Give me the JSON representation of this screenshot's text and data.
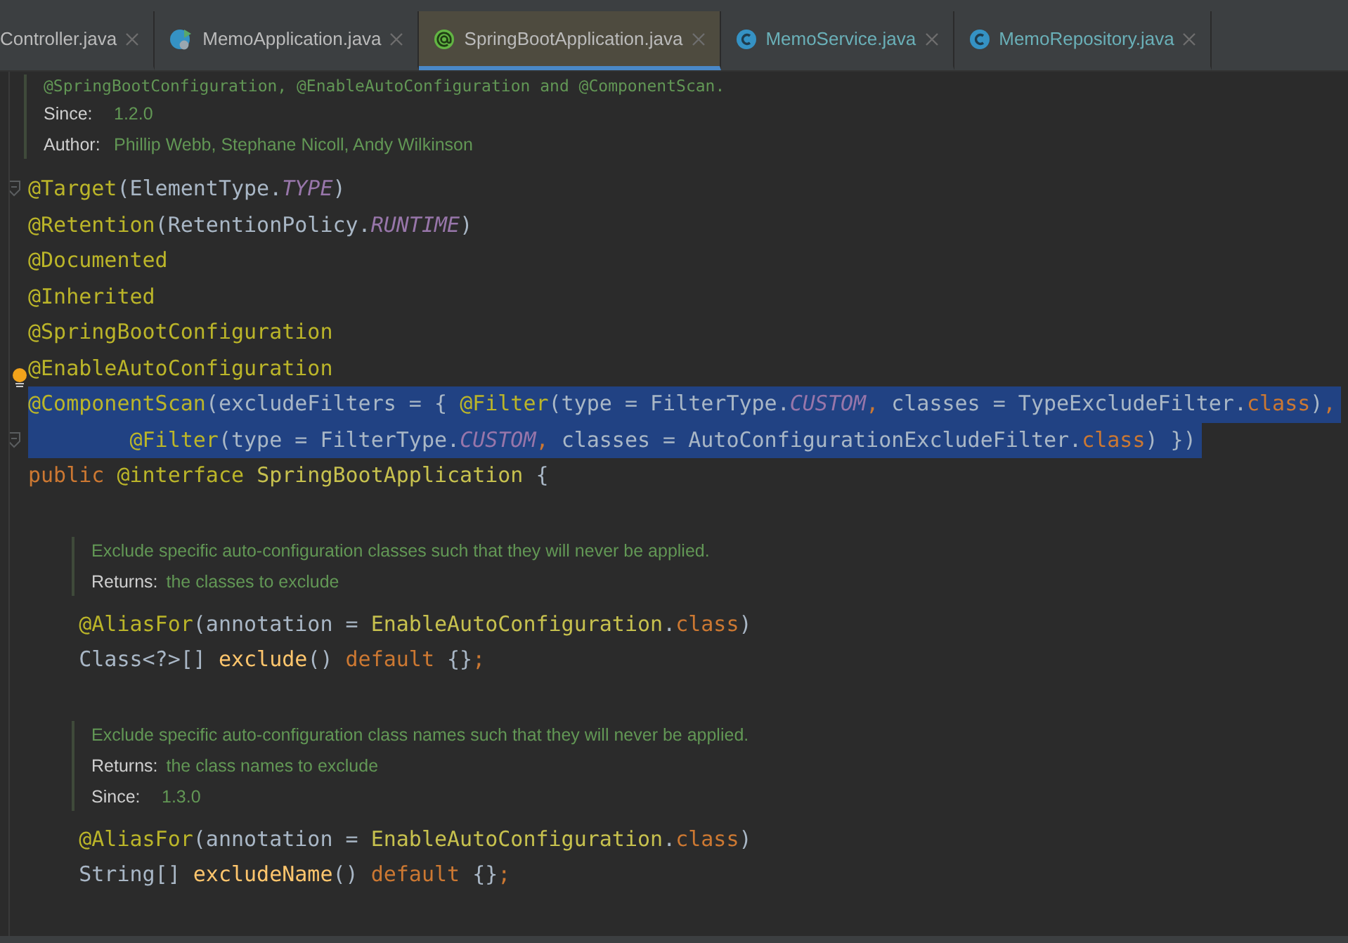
{
  "tabs": [
    {
      "label": "Controller.java",
      "kind": "none",
      "selected": false,
      "color": "#bbbbbb"
    },
    {
      "label": "MemoApplication.java",
      "kind": "app-class",
      "selected": false,
      "color": "#bbbbbb"
    },
    {
      "label": "SpringBootApplication.java",
      "kind": "annotation",
      "selected": true,
      "color": "#bbbbbb"
    },
    {
      "label": "MemoService.java",
      "kind": "class",
      "selected": false,
      "color": "#6ab0b8"
    },
    {
      "label": "MemoRepository.java",
      "kind": "class",
      "selected": false,
      "color": "#6ab0b8"
    }
  ],
  "editor": {
    "blocks": [
      {
        "kind": "doc",
        "indented": false,
        "lines": [
          {
            "kind": "mono",
            "text": "@SpringBootConfiguration, @EnableAutoConfiguration and @ComponentScan."
          },
          {
            "kind": "field",
            "label": "Since:",
            "text": "1.2.0"
          },
          {
            "kind": "field",
            "label": "Author:",
            "text": "Phillip Webb, Stephane Nicoll, Andy Wilkinson"
          }
        ]
      },
      {
        "kind": "code",
        "fold": true,
        "bulb": false,
        "selected": false,
        "tokens": [
          {
            "t": "@Target",
            "kind": "annotation"
          },
          {
            "t": "(ElementType.",
            "kind": "plain"
          },
          {
            "t": "TYPE",
            "kind": "constant"
          },
          {
            "t": ")",
            "kind": "plain"
          }
        ]
      },
      {
        "kind": "code",
        "fold": false,
        "bulb": false,
        "selected": false,
        "tokens": [
          {
            "t": "@Retention",
            "kind": "annotation"
          },
          {
            "t": "(RetentionPolicy.",
            "kind": "plain"
          },
          {
            "t": "RUNTIME",
            "kind": "constant"
          },
          {
            "t": ")",
            "kind": "plain"
          }
        ]
      },
      {
        "kind": "code",
        "fold": false,
        "bulb": false,
        "selected": false,
        "tokens": [
          {
            "t": "@Documented",
            "kind": "annotation"
          }
        ]
      },
      {
        "kind": "code",
        "fold": false,
        "bulb": false,
        "selected": false,
        "tokens": [
          {
            "t": "@Inherited",
            "kind": "annotation"
          }
        ]
      },
      {
        "kind": "code",
        "fold": false,
        "bulb": false,
        "selected": false,
        "tokens": [
          {
            "t": "@SpringBootConfiguration",
            "kind": "annotation"
          }
        ]
      },
      {
        "kind": "code",
        "fold": false,
        "bulb": true,
        "selected": false,
        "tokens": [
          {
            "t": "@EnableAutoConfiguration",
            "kind": "annotation"
          }
        ]
      },
      {
        "kind": "code",
        "fold": false,
        "bulb": false,
        "selected": true,
        "tokens": [
          {
            "t": "@ComponentScan",
            "kind": "annotation"
          },
          {
            "t": "(excludeFilters = { ",
            "kind": "plain"
          },
          {
            "t": "@Filter",
            "kind": "annotation"
          },
          {
            "t": "(type = FilterType.",
            "kind": "plain"
          },
          {
            "t": "CUSTOM",
            "kind": "constant"
          },
          {
            "t": ", ",
            "kind": "keyword"
          },
          {
            "t": "classes = TypeExcludeFilter.",
            "kind": "plain"
          },
          {
            "t": "class",
            "kind": "keyword"
          },
          {
            "t": ")",
            "kind": "plain"
          },
          {
            "t": ",",
            "kind": "keyword"
          }
        ]
      },
      {
        "kind": "code",
        "fold": true,
        "bulb": false,
        "selected": true,
        "tokens": [
          {
            "t": "        @Filter",
            "kind": "annotation"
          },
          {
            "t": "(type = FilterType.",
            "kind": "plain"
          },
          {
            "t": "CUSTOM",
            "kind": "constant"
          },
          {
            "t": ", ",
            "kind": "keyword"
          },
          {
            "t": "classes = AutoConfigurationExcludeFilter.",
            "kind": "plain"
          },
          {
            "t": "class",
            "kind": "keyword"
          },
          {
            "t": ") })",
            "kind": "plain"
          }
        ]
      },
      {
        "kind": "code",
        "fold": false,
        "bulb": false,
        "selected": false,
        "tokens": [
          {
            "t": "public ",
            "kind": "keyword"
          },
          {
            "t": "@interface ",
            "kind": "annotation"
          },
          {
            "t": "SpringBootApplication ",
            "kind": "type"
          },
          {
            "t": "{",
            "kind": "plain"
          }
        ]
      },
      {
        "kind": "blank"
      },
      {
        "kind": "doc",
        "indented": true,
        "lines": [
          {
            "kind": "text",
            "text": "Exclude specific auto-configuration classes such that they will never be applied."
          },
          {
            "kind": "field",
            "label": "Returns:",
            "text": "the classes to exclude"
          }
        ]
      },
      {
        "kind": "code",
        "fold": false,
        "bulb": false,
        "selected": false,
        "tokens": [
          {
            "t": "    @AliasFor",
            "kind": "annotation"
          },
          {
            "t": "(annotation = ",
            "kind": "plain"
          },
          {
            "t": "EnableAutoConfiguration",
            "kind": "type"
          },
          {
            "t": ".",
            "kind": "plain"
          },
          {
            "t": "class",
            "kind": "keyword"
          },
          {
            "t": ")",
            "kind": "plain"
          }
        ]
      },
      {
        "kind": "code",
        "fold": false,
        "bulb": false,
        "selected": false,
        "tokens": [
          {
            "t": "    Class<?>[] ",
            "kind": "plain"
          },
          {
            "t": "exclude",
            "kind": "method"
          },
          {
            "t": "() ",
            "kind": "plain"
          },
          {
            "t": "default ",
            "kind": "keyword"
          },
          {
            "t": "{}",
            "kind": "plain"
          },
          {
            "t": ";",
            "kind": "keyword"
          }
        ]
      },
      {
        "kind": "blank"
      },
      {
        "kind": "doc",
        "indented": true,
        "lines": [
          {
            "kind": "text",
            "text": "Exclude specific auto-configuration class names such that they will never be applied."
          },
          {
            "kind": "field",
            "label": "Returns:",
            "text": "the class names to exclude"
          },
          {
            "kind": "field",
            "label": "Since:",
            "text": "1.3.0"
          }
        ]
      },
      {
        "kind": "code",
        "fold": false,
        "bulb": false,
        "selected": false,
        "tokens": [
          {
            "t": "    @AliasFor",
            "kind": "annotation"
          },
          {
            "t": "(annotation = ",
            "kind": "plain"
          },
          {
            "t": "EnableAutoConfiguration",
            "kind": "type"
          },
          {
            "t": ".",
            "kind": "plain"
          },
          {
            "t": "class",
            "kind": "keyword"
          },
          {
            "t": ")",
            "kind": "plain"
          }
        ]
      },
      {
        "kind": "code",
        "fold": false,
        "bulb": false,
        "selected": false,
        "tokens": [
          {
            "t": "    String[] ",
            "kind": "plain"
          },
          {
            "t": "excludeName",
            "kind": "method"
          },
          {
            "t": "() ",
            "kind": "plain"
          },
          {
            "t": "default ",
            "kind": "keyword"
          },
          {
            "t": "{}",
            "kind": "plain"
          },
          {
            "t": ";",
            "kind": "keyword"
          }
        ]
      }
    ]
  }
}
